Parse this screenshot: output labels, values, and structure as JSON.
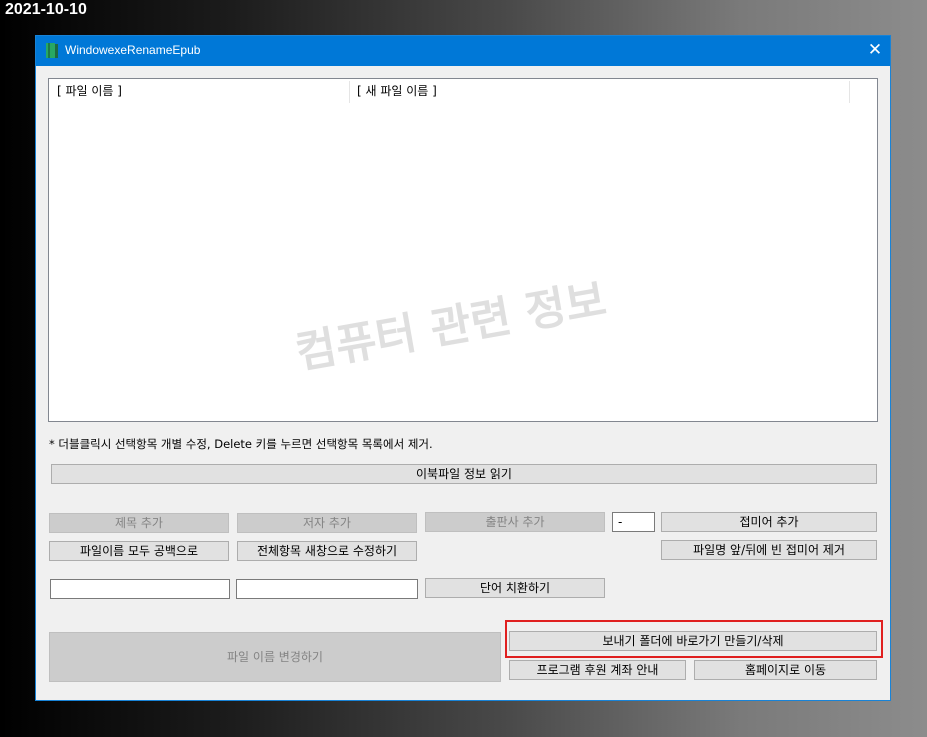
{
  "date": "2021-10-10",
  "window": {
    "title": "WindowexeRenameEpub",
    "close_glyph": "✕"
  },
  "list": {
    "col1": "[ 파일 이름 ]",
    "col2": "[ 새 파일 이름 ]",
    "watermark": "컴퓨터 관련 정보"
  },
  "hint": "* 더블클릭시 선택항목 개별 수정, Delete 키를 누르면 선택항목 목록에서 제거.",
  "buttons": {
    "read_info": "이북파일 정보 읽기",
    "add_title": "제목 추가",
    "add_author": "저자 추가",
    "add_publisher": "출판사 추가",
    "add_affix": "접미어 추가",
    "all_space": "파일이름 모두 공백으로",
    "edit_all": "전체항목 새창으로 수정하기",
    "remove_affix": "파일명 앞/뒤에 빈 접미어 제거",
    "replace": "단어 치환하기",
    "rename": "파일 이름 변경하기",
    "shortcut": "보내기 폴더에 바로가기 만들기/삭제",
    "support": "프로그램 후원 계좌 안내",
    "homepage": "홈페이지로 이동"
  },
  "inputs": {
    "separator": "-",
    "find": "",
    "replace_with": ""
  },
  "icons": {
    "app": "book-icon"
  },
  "colors": {
    "titlebar": "#0078d7",
    "highlight": "#e02020"
  }
}
